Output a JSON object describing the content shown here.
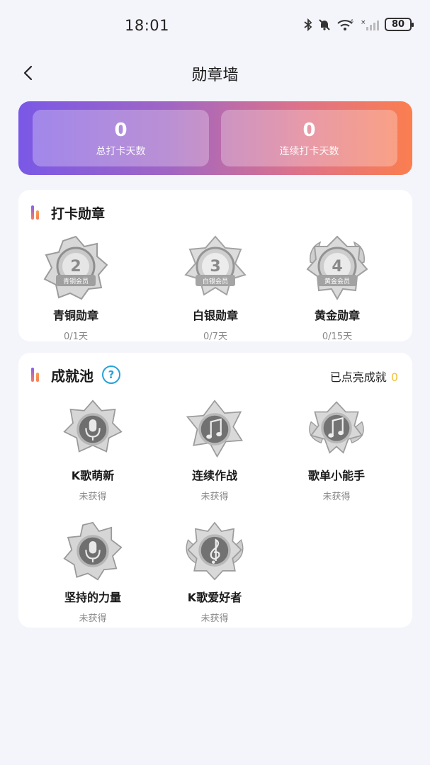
{
  "status_bar": {
    "time": "18:01",
    "battery": "80"
  },
  "header": {
    "title": "勋章墙"
  },
  "stats": {
    "total_days_value": "0",
    "total_days_label": "总打卡天数",
    "streak_days_value": "0",
    "streak_days_label": "连续打卡天数"
  },
  "checkin_section": {
    "title": "打卡勋章",
    "badges": [
      {
        "name": "青铜勋章",
        "progress": "0/1天",
        "rank_number": "2",
        "rank_label": "青铜会员"
      },
      {
        "name": "白银勋章",
        "progress": "0/7天",
        "rank_number": "3",
        "rank_label": "白银会员"
      },
      {
        "name": "黄金勋章",
        "progress": "0/15天",
        "rank_number": "4",
        "rank_label": "黄金会员"
      }
    ]
  },
  "achievement_section": {
    "title": "成就池",
    "help_symbol": "?",
    "lit_label": "已点亮成就",
    "lit_count": "0",
    "items": [
      {
        "name": "K歌萌新",
        "status": "未获得",
        "icon": "microphone-icon"
      },
      {
        "name": "连续作战",
        "status": "未获得",
        "icon": "music-note-icon"
      },
      {
        "name": "歌单小能手",
        "status": "未获得",
        "icon": "music-note-icon"
      },
      {
        "name": "坚持的力量",
        "status": "未获得",
        "icon": "microphone-icon"
      },
      {
        "name": "K歌爱好者",
        "status": "未获得",
        "icon": "treble-clef-icon"
      }
    ]
  },
  "colors": {
    "gradient_start": "#7a58e6",
    "gradient_end": "#fb7e4f",
    "help_blue": "#26a3d8",
    "lit_count_yellow": "#f2c23a"
  }
}
